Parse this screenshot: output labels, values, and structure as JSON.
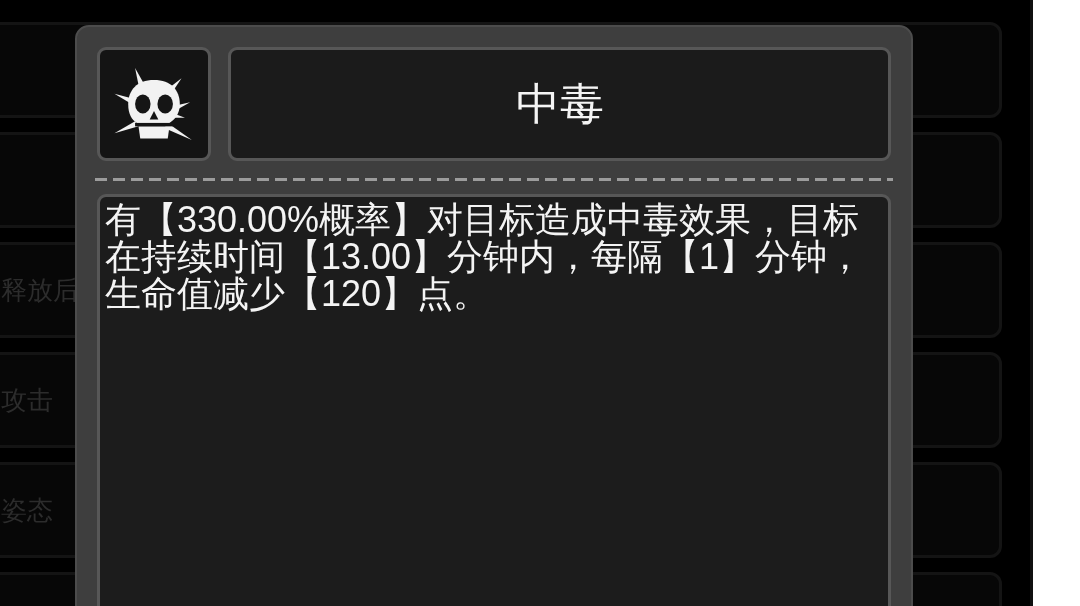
{
  "background_list": {
    "rows": [
      {
        "kind": "blank"
      },
      {
        "kind": "blank"
      },
      {
        "kind": "labeled",
        "label": "释放后"
      },
      {
        "kind": "labeled",
        "label": "攻击"
      },
      {
        "kind": "labeled",
        "label": "姿态"
      },
      {
        "kind": "blank"
      }
    ]
  },
  "dialog": {
    "title": "中毒",
    "description": "有【330.00%概率】对目标造成中毒效果，目标在持续时间【13.00】分钟内，每隔【1】分钟，生命值减少【120】点。"
  }
}
